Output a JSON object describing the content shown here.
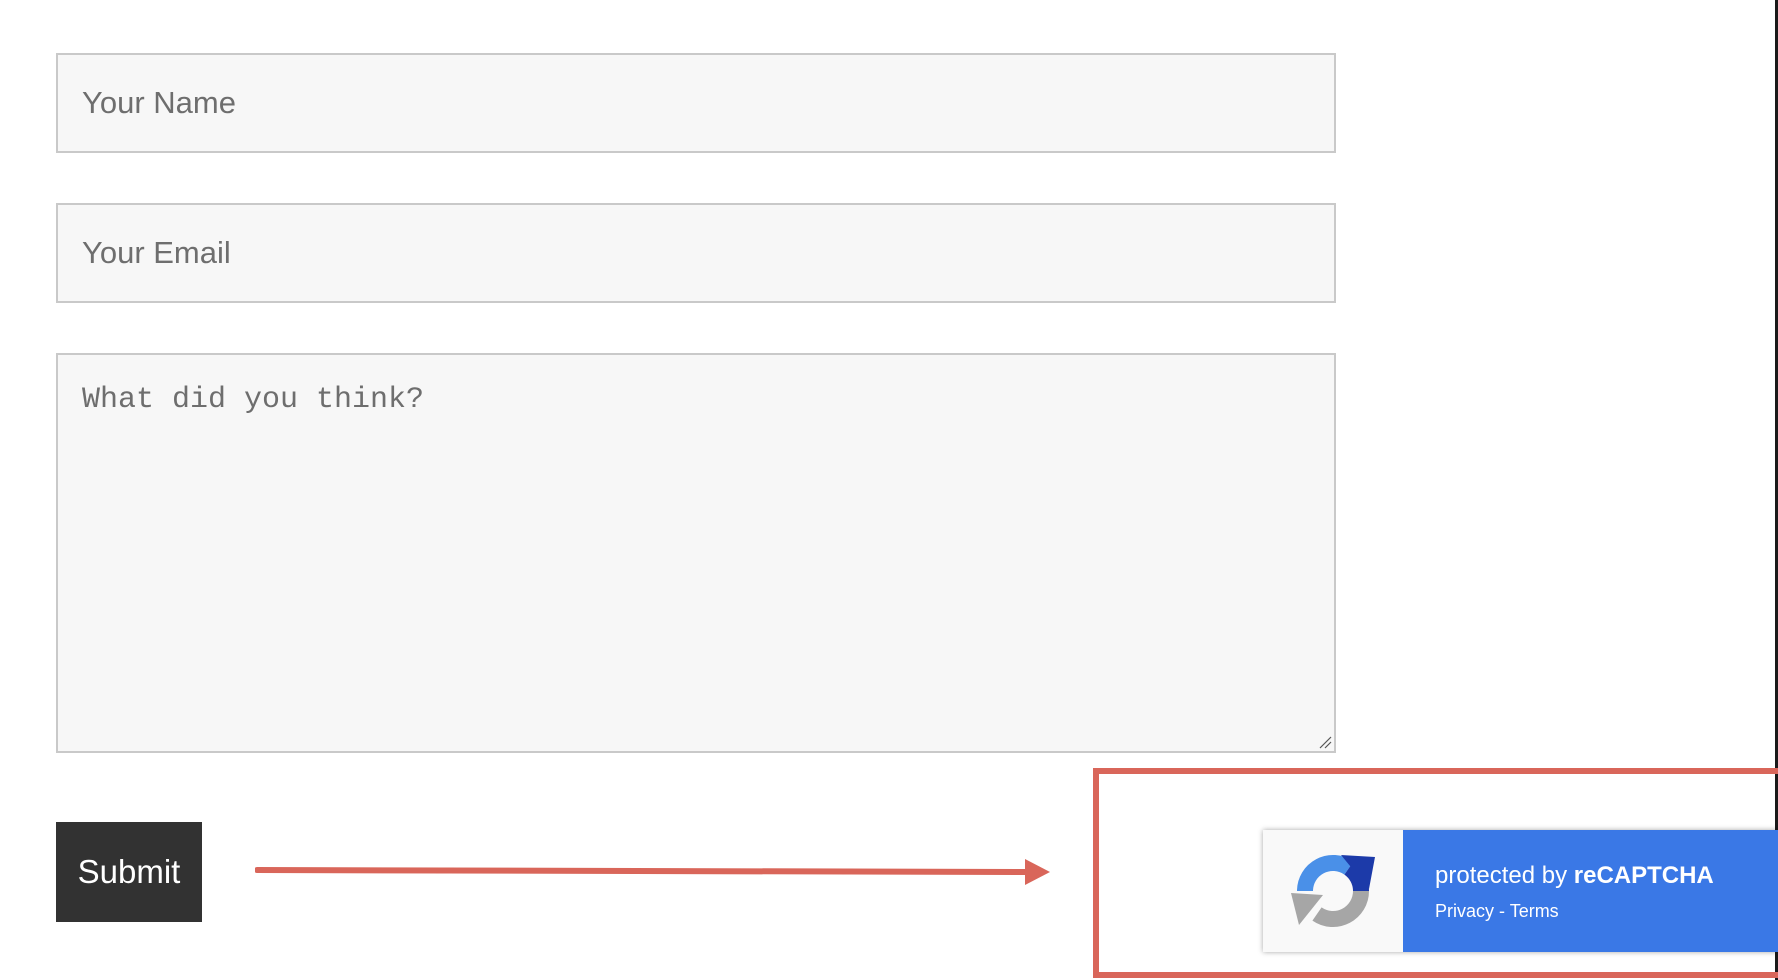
{
  "form": {
    "name_placeholder": "Your Name",
    "email_placeholder": "Your Email",
    "message_placeholder": "What did you think?",
    "submit_label": "Submit"
  },
  "recaptcha": {
    "protected_prefix": "protected by ",
    "brand": "reCAPTCHA",
    "privacy_label": "Privacy",
    "separator": " - ",
    "terms_label": "Terms",
    "icon": "recaptcha-logo-icon"
  },
  "colors": {
    "field_background": "#f7f7f7",
    "field_border": "#c9c9c9",
    "submit_background": "#323232",
    "annotation": "#d9665a",
    "recaptcha_blue": "#3a78e6"
  }
}
